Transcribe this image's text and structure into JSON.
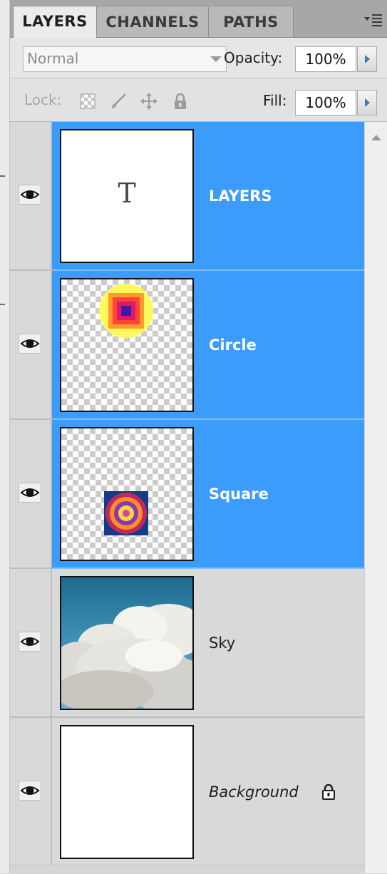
{
  "tabs": [
    {
      "label": "LAYERS",
      "active": true
    },
    {
      "label": "CHANNELS",
      "active": false
    },
    {
      "label": "PATHS",
      "active": false
    }
  ],
  "options": {
    "blend_mode": "Normal",
    "opacity_label": "Opacity:",
    "opacity_value": "100%",
    "lock_label": "Lock:",
    "fill_label": "Fill:",
    "fill_value": "100%"
  },
  "layers": [
    {
      "name": "LAYERS",
      "selected": true,
      "visible": true,
      "thumbnail": "text-layer",
      "thumb_glyph": "T"
    },
    {
      "name": "Circle",
      "selected": true,
      "visible": true,
      "thumbnail": "gradient-square-on-transparent"
    },
    {
      "name": "Square",
      "selected": true,
      "visible": true,
      "thumbnail": "radial-circle-on-transparent"
    },
    {
      "name": "Sky",
      "selected": false,
      "visible": true,
      "thumbnail": "sky-photo"
    },
    {
      "name": "Background",
      "selected": false,
      "visible": true,
      "thumbnail": "white",
      "locked": true
    }
  ],
  "colors": {
    "selection": "#3c9cfb",
    "panel": "#d6d6d6"
  }
}
